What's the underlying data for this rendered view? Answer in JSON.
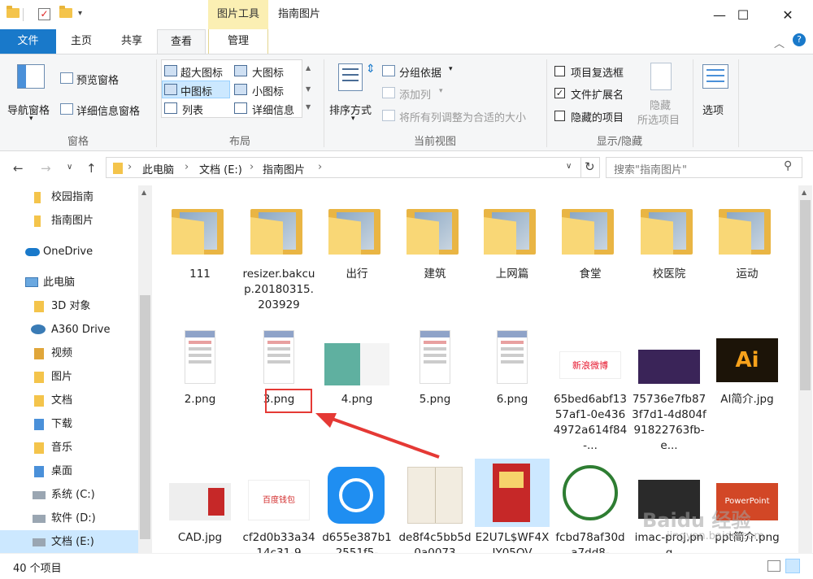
{
  "window": {
    "title": "指南图片",
    "context_tab": "图片工具",
    "minimize": "—",
    "maximize": "☐",
    "close": "✕"
  },
  "ribbon_tabs": [
    "文件",
    "主页",
    "共享",
    "查看",
    "管理"
  ],
  "ribbon": {
    "pane_group": {
      "nav_pane": "导航窗格",
      "preview_pane": "预览窗格",
      "details_pane": "详细信息窗格",
      "label": "窗格"
    },
    "layout_group": {
      "items": [
        "超大图标",
        "大图标",
        "中图标",
        "小图标",
        "列表",
        "详细信息"
      ],
      "selected": "中图标",
      "label": "布局"
    },
    "current_view_group": {
      "sort": "排序方式",
      "group_by": "分组依据",
      "add_column": "添加列",
      "fit_columns": "将所有列调整为合适的大小",
      "label": "当前视图"
    },
    "show_hide_group": {
      "item_checkboxes": "项目复选框",
      "file_extensions": "文件扩展名",
      "hidden_items": "隐藏的项目",
      "hide_selected_line1": "隐藏",
      "hide_selected_line2": "所选项目",
      "label": "显示/隐藏"
    },
    "options": "选项"
  },
  "address": {
    "path": [
      "此电脑",
      "文档 (E:)",
      "指南图片"
    ],
    "search_placeholder": "搜索\"指南图片\""
  },
  "nav_pane": [
    {
      "label": "校园指南",
      "icon": "folder-icon"
    },
    {
      "label": "指南图片",
      "icon": "folder-icon"
    },
    {
      "label": "OneDrive",
      "icon": "cloud-icon"
    },
    {
      "label": "此电脑",
      "icon": "computer-icon"
    },
    {
      "label": "3D 对象",
      "icon": "3d-objects-icon"
    },
    {
      "label": "A360 Drive",
      "icon": "a360-icon"
    },
    {
      "label": "视频",
      "icon": "video-icon"
    },
    {
      "label": "图片",
      "icon": "pictures-icon"
    },
    {
      "label": "文档",
      "icon": "documents-icon"
    },
    {
      "label": "下载",
      "icon": "download-icon"
    },
    {
      "label": "音乐",
      "icon": "music-icon"
    },
    {
      "label": "桌面",
      "icon": "desktop-icon"
    },
    {
      "label": "系统 (C:)",
      "icon": "drive-icon"
    },
    {
      "label": "软件 (D:)",
      "icon": "drive-icon"
    },
    {
      "label": "文档 (E:)",
      "icon": "drive-icon"
    }
  ],
  "files": [
    {
      "name": "111",
      "kind": "folder"
    },
    {
      "name": "resizer.bakcup.20180315.203929",
      "kind": "folder"
    },
    {
      "name": "出行",
      "kind": "folder"
    },
    {
      "name": "建筑",
      "kind": "folder"
    },
    {
      "name": "上网篇",
      "kind": "folder"
    },
    {
      "name": "食堂",
      "kind": "folder"
    },
    {
      "name": "校医院",
      "kind": "folder"
    },
    {
      "name": "运动",
      "kind": "folder"
    },
    {
      "name": "2.png",
      "kind": "phone"
    },
    {
      "name": "3.png",
      "kind": "phone"
    },
    {
      "name": "4.png",
      "kind": "wide"
    },
    {
      "name": "5.png",
      "kind": "phone"
    },
    {
      "name": "6.png",
      "kind": "phone"
    },
    {
      "name": "65bed6abf1357af1-0e4364972a614f84-...",
      "kind": "weibo"
    },
    {
      "name": "75736e7fb873f7d1-4d804f91822763fb-e...",
      "kind": "purple"
    },
    {
      "name": "AI简介.jpg",
      "kind": "ai"
    },
    {
      "name": "CAD.jpg",
      "kind": "cad"
    },
    {
      "name": "cf2d0b33a3414c31-9",
      "kind": "baidu"
    },
    {
      "name": "d655e387b12551f5-",
      "kind": "video"
    },
    {
      "name": "de8f4c5bb5d0a0073",
      "kind": "book"
    },
    {
      "name": "E2U7L$WF4XIY05OV",
      "kind": "poster"
    },
    {
      "name": "fcbd78af30da7dd8-",
      "kind": "emblem"
    },
    {
      "name": "imac-proj.png",
      "kind": "imac"
    },
    {
      "name": "ppt简介.png",
      "kind": "ppt"
    }
  ],
  "ai_logo_text": "Ai",
  "ppt_logo_text": "PowerPoint",
  "weibo_text": "新浪微博",
  "baidu_text": "百度钱包",
  "status": {
    "count": "40 个项目"
  },
  "watermark": "Baidu 经验  jingyan.baidu.com"
}
